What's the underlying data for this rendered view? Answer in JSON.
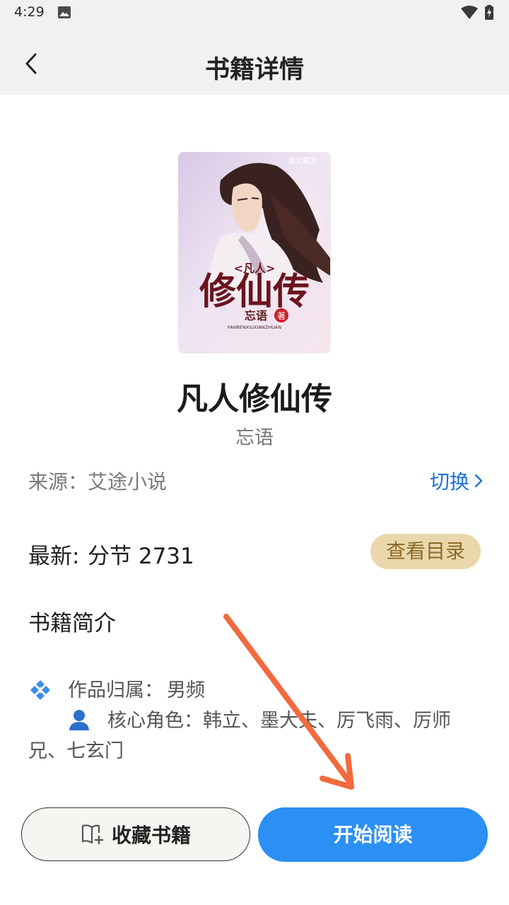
{
  "status_bar": {
    "time": "4:29",
    "icons": [
      "photo-icon",
      "wifi-icon",
      "battery-charging-icon"
    ]
  },
  "header": {
    "title": "书籍详情",
    "back_icon": "chevron-left-icon"
  },
  "book": {
    "cover_text": {
      "publisher": "阅文集团",
      "series": "<凡人>",
      "title": "修仙传",
      "author": "忘语",
      "author_mark": "著",
      "pinyin": "FANRENXIUXIANZHUAN"
    },
    "title": "凡人修仙传",
    "author": "忘语"
  },
  "source": {
    "label": "来源：",
    "value": "艾途小说",
    "switch_label": "切换"
  },
  "latest": {
    "label": "最新:",
    "value": "分节 2731",
    "toc_button": "查看目录"
  },
  "intro": {
    "heading": "书籍简介",
    "belong_label": "作品归属：",
    "belong_value": "男频",
    "roles_text": "核心角色：韩立、墨大夫、厉飞雨、厉师兄、七玄门"
  },
  "actions": {
    "collect_label": "收藏书籍",
    "read_label": "开始阅读"
  },
  "colors": {
    "accent_blue": "#2b8ff3",
    "link_blue": "#1d6fd6",
    "toc_bg": "#ead8ac",
    "toc_text": "#8b6a25",
    "annotation_arrow": "#f26a3d"
  }
}
